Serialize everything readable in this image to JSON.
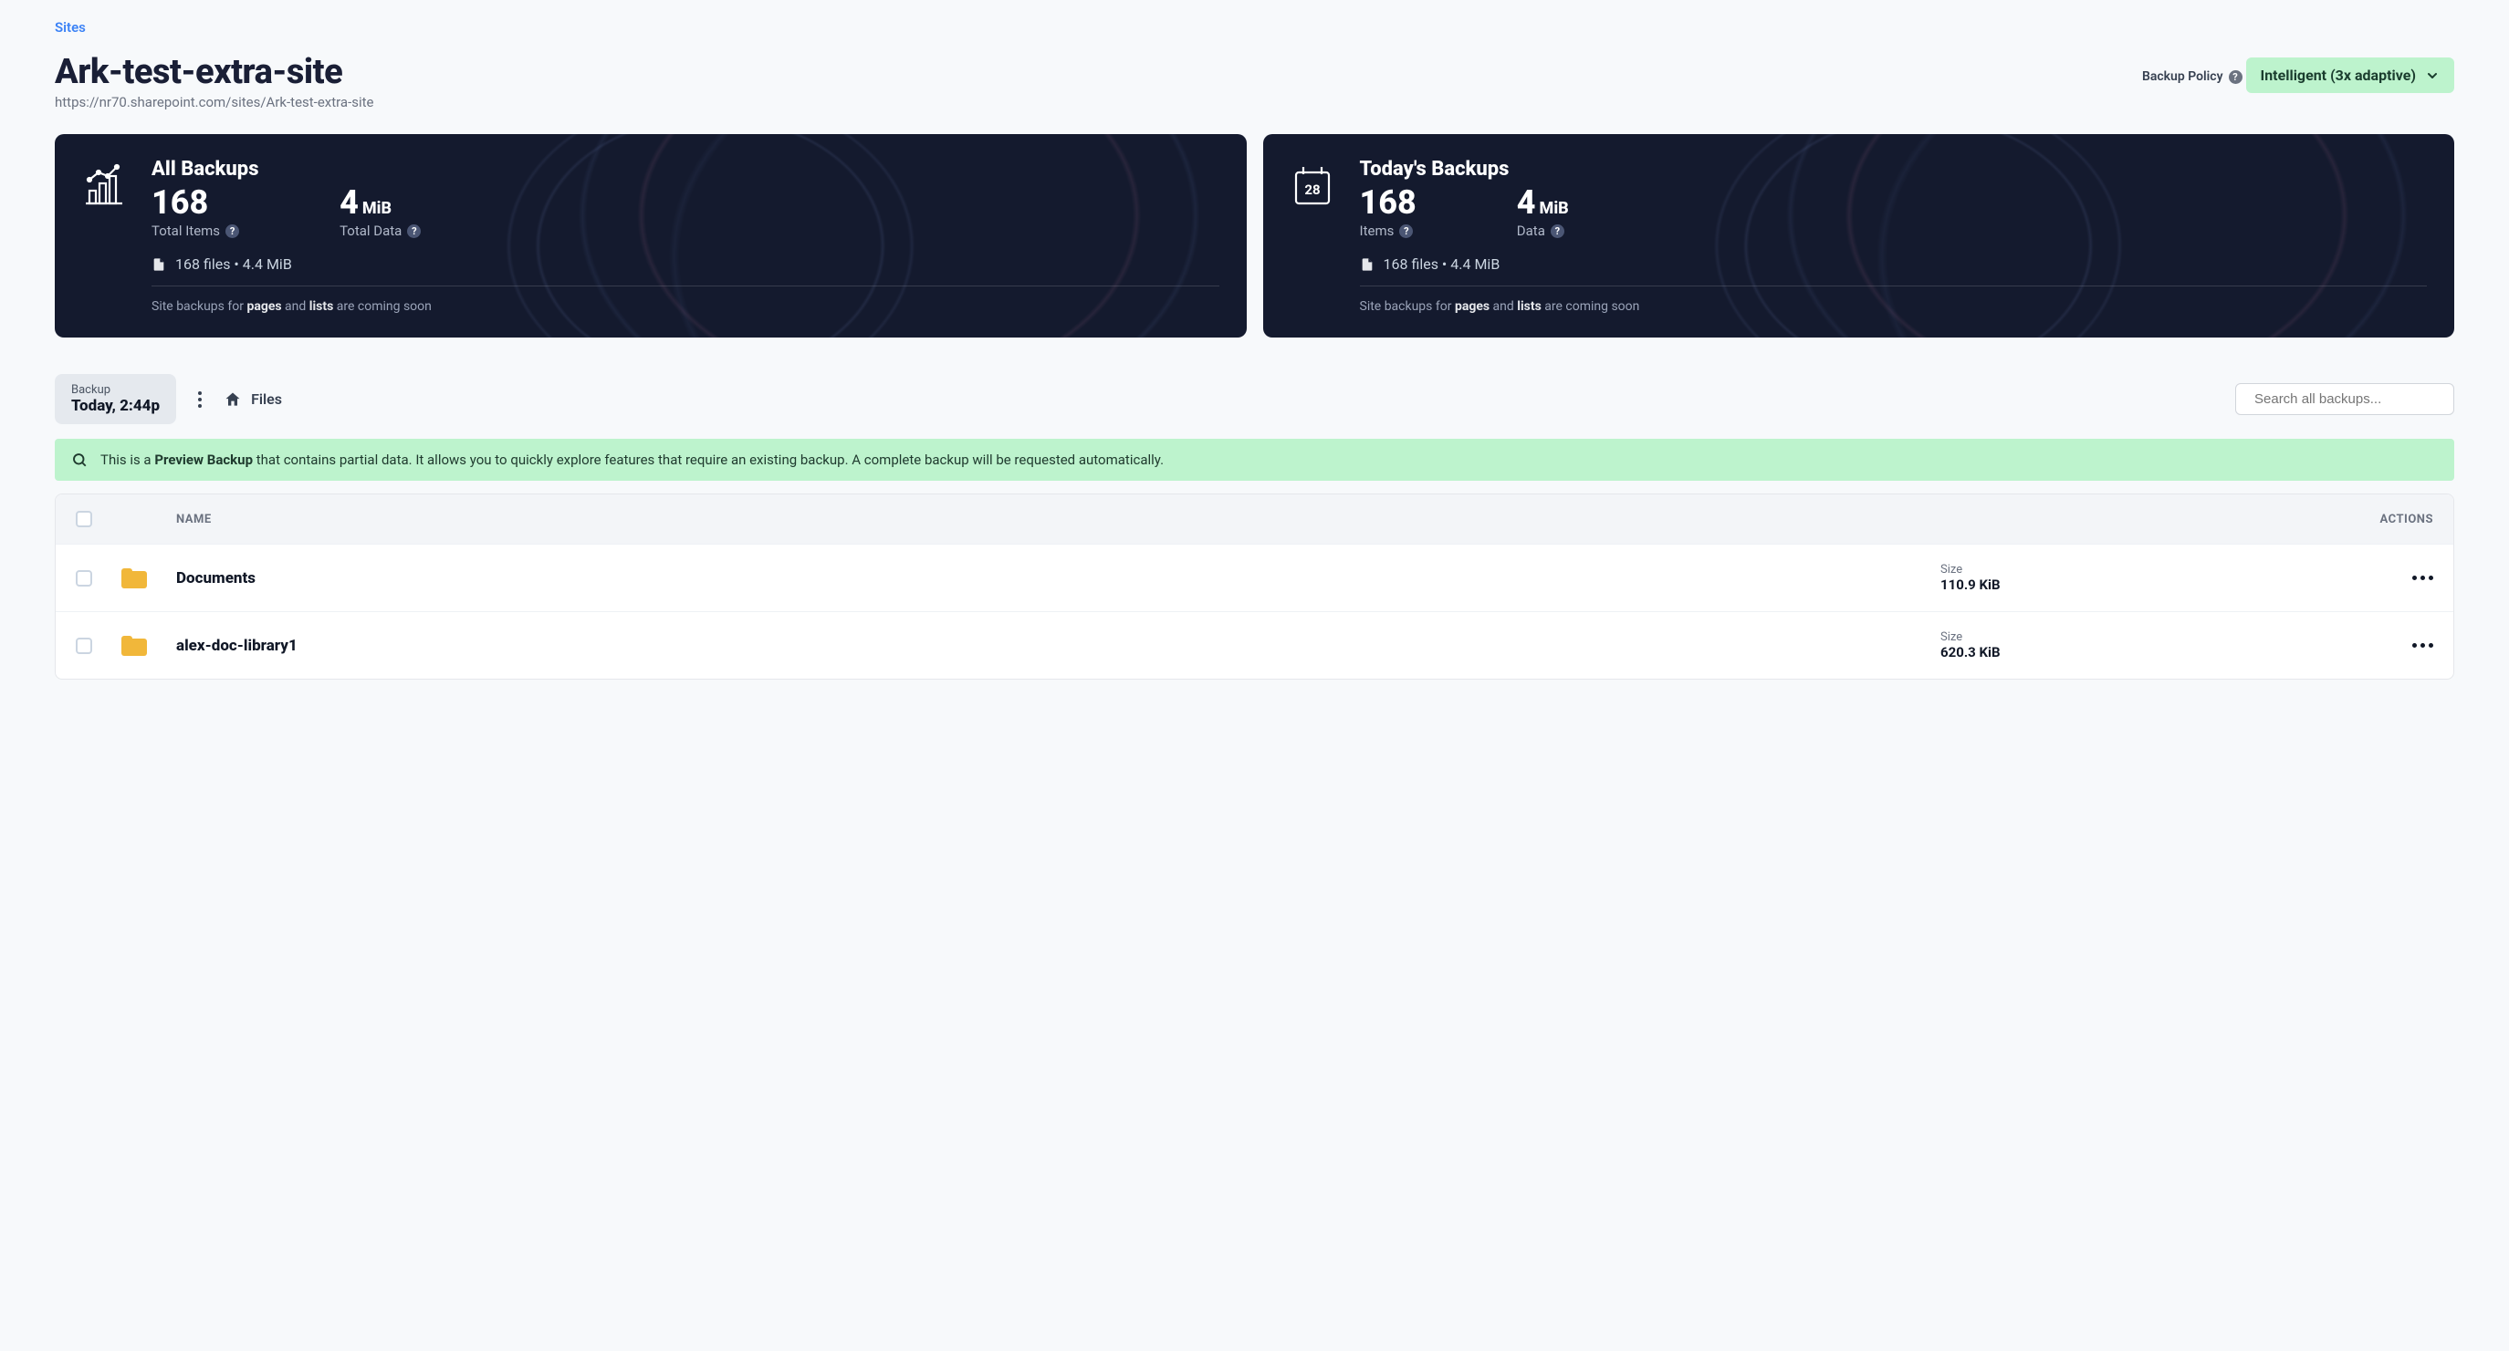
{
  "breadcrumb": {
    "root": "Sites"
  },
  "page": {
    "title": "Ark-test-extra-site",
    "url": "https://nr70.sharepoint.com/sites/Ark-test-extra-site"
  },
  "policy": {
    "label": "Backup Policy",
    "value": "Intelligent (3x adaptive)"
  },
  "cards": {
    "all": {
      "title": "All Backups",
      "items_value": "168",
      "items_label": "Total Items",
      "data_value": "4",
      "data_unit": "MiB",
      "data_label": "Total Data",
      "file_line": "168 files • 4.4 MiB",
      "note_prefix": "Site backups for ",
      "note_b1": "pages",
      "note_mid": " and ",
      "note_b2": "lists",
      "note_suffix": " are coming soon"
    },
    "today": {
      "title": "Today's Backups",
      "day_number": "28",
      "items_value": "168",
      "items_label": "Items",
      "data_value": "4",
      "data_unit": "MiB",
      "data_label": "Data",
      "file_line": "168 files • 4.4 MiB",
      "note_prefix": "Site backups for ",
      "note_b1": "pages",
      "note_mid": " and ",
      "note_b2": "lists",
      "note_suffix": " are coming soon"
    }
  },
  "toolbar": {
    "backup_label": "Backup",
    "backup_value": "Today, 2:44p",
    "files_crumb": "Files",
    "search_placeholder": "Search all backups..."
  },
  "banner": {
    "prefix": "This is a ",
    "bold": "Preview Backup",
    "suffix": " that contains partial data. It allows you to quickly explore features that require an existing backup. A complete backup will be requested automatically."
  },
  "table": {
    "head_name": "NAME",
    "head_actions": "ACTIONS",
    "size_label": "Size",
    "rows": [
      {
        "name": "Documents",
        "size": "110.9 KiB"
      },
      {
        "name": "alex-doc-library1",
        "size": "620.3 KiB"
      }
    ]
  }
}
